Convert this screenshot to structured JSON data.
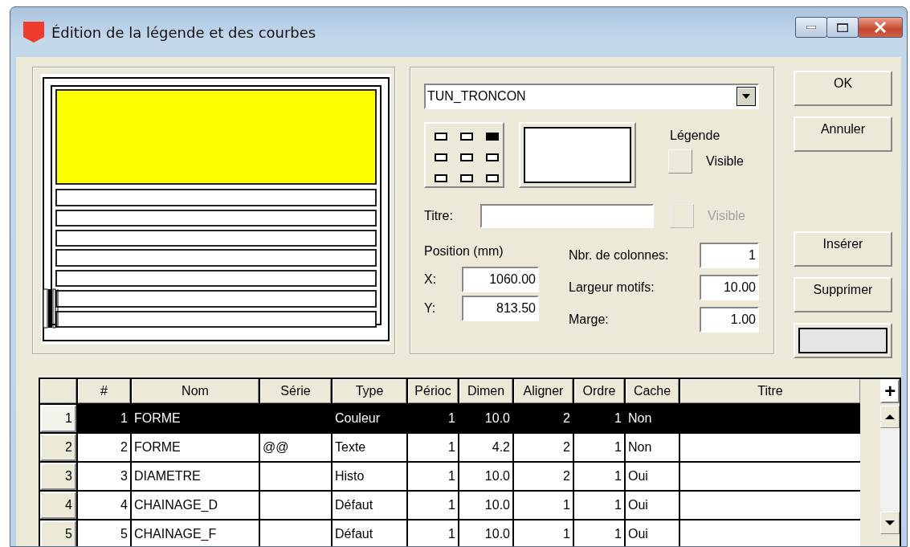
{
  "window": {
    "title": "Édition de la légende et des courbes"
  },
  "layer_dropdown": {
    "value": "TUN_TRONCON"
  },
  "anchor_grid": [
    {
      "selected": false
    },
    {
      "selected": false
    },
    {
      "selected": true
    },
    {
      "selected": false
    },
    {
      "selected": false
    },
    {
      "selected": false
    },
    {
      "selected": false
    },
    {
      "selected": false
    },
    {
      "selected": false
    }
  ],
  "legend": {
    "label": "Légende",
    "visible": {
      "label": "Visible",
      "checked": false,
      "disabled": false
    }
  },
  "title_field": {
    "label": "Titre:",
    "visible": {
      "label": "Visible",
      "checked": false,
      "disabled": true
    }
  },
  "position": {
    "label": "Position (mm)",
    "fields": [
      {
        "label": "X:",
        "value": "1060.00"
      },
      {
        "label": "Y:",
        "value": "813.50"
      }
    ]
  },
  "settings": [
    {
      "label": "Nbr. de colonnes:",
      "value": "1"
    },
    {
      "label": "Largeur motifs:",
      "value": "10.00"
    },
    {
      "label": "Marge:",
      "value": "1.00"
    }
  ],
  "buttons": [
    {
      "label": "OK"
    },
    {
      "label": "Annuler"
    }
  ],
  "edit_buttons": [
    {
      "label": "Insérer"
    },
    {
      "label": "Supprimer"
    }
  ],
  "table": {
    "add_button": "+",
    "columns": [
      "#",
      "Nom",
      "Série",
      "Type",
      "Périoc",
      "Dimen",
      "Aligner",
      "Ordre",
      "Cache",
      "Titre"
    ],
    "rows": [
      {
        "header": "1",
        "selected": true,
        "cells": [
          "1",
          "FORME",
          "",
          "Couleur",
          "1",
          "10.0",
          "2",
          "1",
          "Non",
          ""
        ]
      },
      {
        "header": "2",
        "selected": false,
        "cells": [
          "2",
          "FORME",
          "@@",
          "Texte",
          "1",
          "4.2",
          "2",
          "1",
          "Non",
          ""
        ]
      },
      {
        "header": "3",
        "selected": false,
        "cells": [
          "3",
          "DIAMETRE",
          "",
          "Histo",
          "1",
          "10.0",
          "2",
          "1",
          "Oui",
          ""
        ]
      },
      {
        "header": "4",
        "selected": false,
        "cells": [
          "4",
          "CHAINAGE_D",
          "",
          "Défaut",
          "1",
          "10.0",
          "1",
          "1",
          "Oui",
          ""
        ]
      },
      {
        "header": "5",
        "selected": false,
        "cells": [
          "5",
          "CHAINAGE_F",
          "",
          "Défaut",
          "1",
          "10.0",
          "1",
          "1",
          "Oui",
          ""
        ]
      }
    ]
  }
}
